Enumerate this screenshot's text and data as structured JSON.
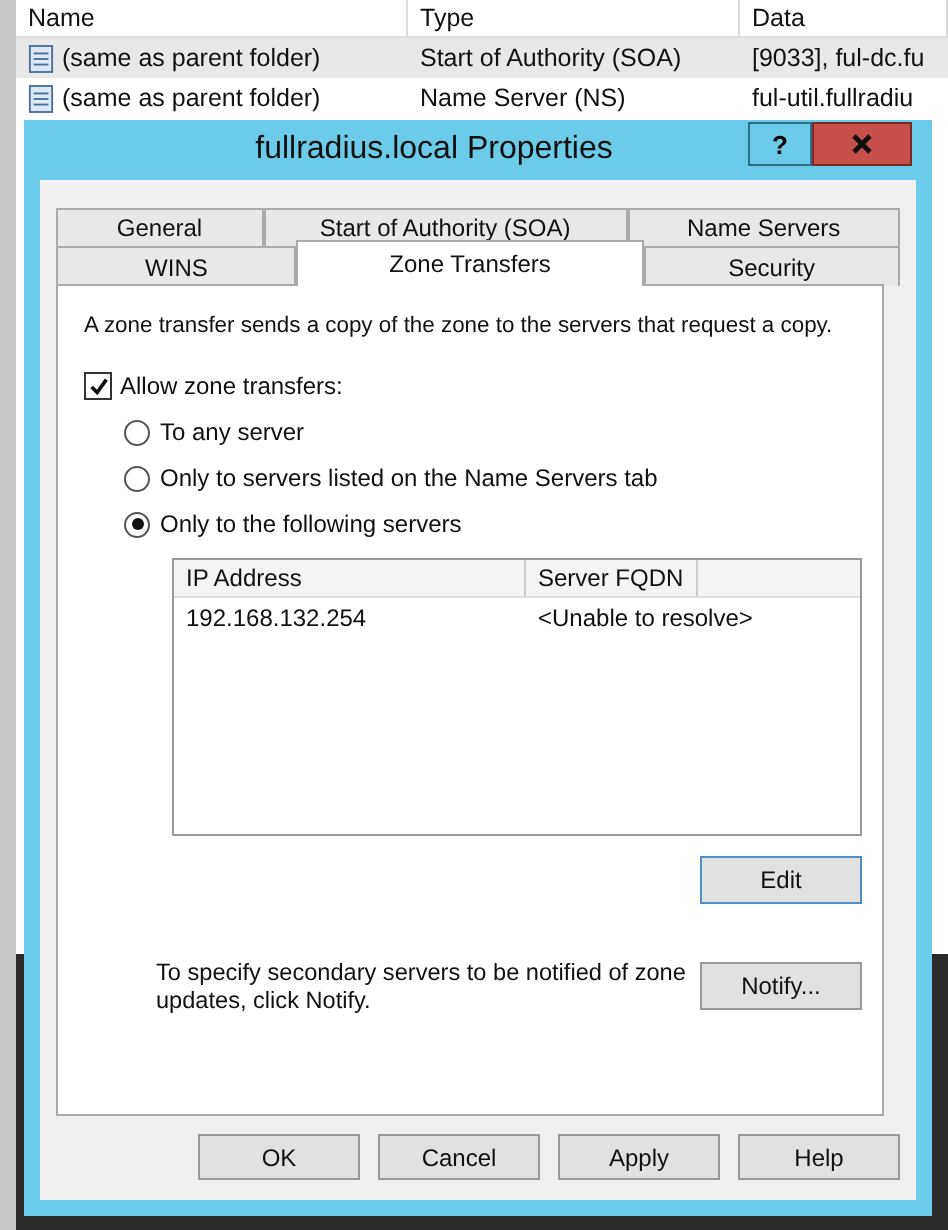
{
  "list": {
    "columns": [
      "Name",
      "Type",
      "Data"
    ],
    "rows": [
      {
        "name": "(same as parent folder)",
        "type": "Start of Authority (SOA)",
        "data": "[9033], ful-dc.fu",
        "selected": true
      },
      {
        "name": "(same as parent folder)",
        "type": "Name Server (NS)",
        "data": "ful-util.fullradiu",
        "selected": false
      }
    ]
  },
  "dialog": {
    "title": "fullradius.local Properties",
    "help": "?",
    "tab_rows": [
      [
        {
          "label": "General",
          "selected": false
        },
        {
          "label": "Start of Authority (SOA)",
          "selected": false
        },
        {
          "label": "Name Servers",
          "selected": false
        }
      ],
      [
        {
          "label": "WINS",
          "selected": false
        },
        {
          "label": "Zone Transfers",
          "selected": true
        },
        {
          "label": "Security",
          "selected": false
        }
      ]
    ],
    "intro": "A zone transfer sends a copy of the zone to the servers that request a copy.",
    "allow": {
      "label": "Allow zone transfers:",
      "checked": true
    },
    "options": [
      {
        "label": "To any server",
        "selected": false
      },
      {
        "label": "Only to servers listed on the Name Servers tab",
        "selected": false
      },
      {
        "label": "Only to the following servers",
        "selected": true
      }
    ],
    "servers": {
      "columns": [
        "IP Address",
        "Server FQDN"
      ],
      "rows": [
        [
          "192.168.132.254",
          "<Unable to resolve>"
        ]
      ]
    },
    "edit_button": "Edit",
    "notify_text": "To specify secondary servers to be notified of zone updates, click Notify.",
    "notify_button": "Notify...",
    "buttons": [
      "OK",
      "Cancel",
      "Apply",
      "Help"
    ]
  }
}
